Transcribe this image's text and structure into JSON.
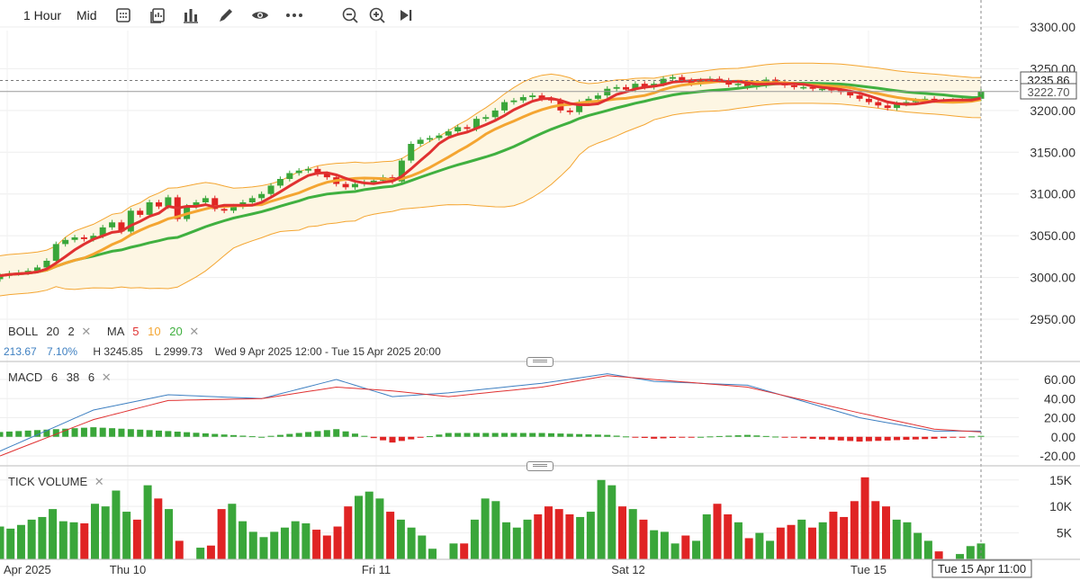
{
  "toolbar": {
    "interval": "1 Hour",
    "price_type": "Mid",
    "icons": [
      "calculator-icon",
      "layers-icon",
      "bar-chart-icon",
      "pencil-icon",
      "eye-icon",
      "more-icon",
      "zoom-out-icon",
      "zoom-in-icon",
      "skip-end-icon"
    ]
  },
  "price_panel": {
    "boll_label": "BOLL",
    "boll_period": "20",
    "boll_mult": "2",
    "ma_label": "MA",
    "ma_periods": [
      "5",
      "10",
      "20"
    ],
    "band_width": "213.67",
    "band_pct": "7.10%",
    "high": "H 3245.85",
    "low": "L 2999.73",
    "range": "Wed 9 Apr 2025 12:00 - Tue 15 Apr 2025 20:00",
    "tag_cursor": "3235.86",
    "tag_last": "3222.70"
  },
  "macd_panel": {
    "label": "MACD",
    "fast": "6",
    "slow": "38",
    "signal": "6"
  },
  "volume_panel": {
    "label": "TICK VOLUME"
  },
  "x_axis": {
    "labels": [
      "Apr 2025",
      "Thu 10",
      "Fri 11",
      "Sat 12",
      "Tue 15"
    ],
    "cursor_label": "Tue 15 Apr 11:00"
  },
  "colors": {
    "up": "#3aa63a",
    "down": "#e02424",
    "ma5": "#e03131",
    "ma10": "#f4a531",
    "ma20": "#40b040",
    "boll": "#f4a531",
    "macd": "#3d7fc1",
    "signal": "#e03131"
  },
  "chart_data": [
    {
      "type": "candlestick",
      "title": "",
      "y_ticks": [
        3300,
        3250,
        3200,
        3150,
        3100,
        3050,
        3000,
        2950
      ],
      "ylim": [
        2925,
        3315
      ],
      "close": [
        3002,
        3005,
        3006,
        3008,
        3012,
        3020,
        3040,
        3045,
        3048,
        3046,
        3050,
        3060,
        3066,
        3055,
        3080,
        3075,
        3090,
        3085,
        3096,
        3070,
        3085,
        3090,
        3095,
        3082,
        3080,
        3085,
        3090,
        3095,
        3100,
        3110,
        3118,
        3125,
        3128,
        3130,
        3124,
        3120,
        3112,
        3108,
        3112,
        3114,
        3116,
        3120,
        3115,
        3140,
        3160,
        3165,
        3167,
        3170,
        3175,
        3180,
        3178,
        3190,
        3192,
        3200,
        3210,
        3212,
        3216,
        3218,
        3214,
        3212,
        3200,
        3198,
        3210,
        3214,
        3218,
        3226,
        3228,
        3225,
        3232,
        3228,
        3232,
        3238,
        3240,
        3236,
        3232,
        3236,
        3238,
        3236,
        3231,
        3232,
        3228,
        3230,
        3237,
        3234,
        3230,
        3228,
        3228,
        3226,
        3226,
        3224,
        3222,
        3218,
        3214,
        3210,
        3206,
        3203,
        3208,
        3210,
        3212,
        3214,
        3212,
        3212,
        3212,
        3213,
        3214,
        3222.7
      ],
      "ma5_color": "#e03131",
      "ma10_color": "#f4a531",
      "ma20_color": "#40b040"
    },
    {
      "type": "line",
      "title": "",
      "y_ticks": [
        60,
        40,
        20,
        0,
        -20
      ],
      "ylim": [
        -27,
        72
      ],
      "macd_start": -15,
      "macd_points": [
        [
          0,
          -15
        ],
        [
          10,
          28
        ],
        [
          18,
          44
        ],
        [
          28,
          40
        ],
        [
          36,
          60
        ],
        [
          42,
          42
        ],
        [
          48,
          46
        ],
        [
          58,
          56
        ],
        [
          65,
          66
        ],
        [
          70,
          58
        ],
        [
          80,
          54
        ],
        [
          92,
          20
        ],
        [
          100,
          6
        ],
        [
          105,
          6
        ]
      ],
      "signal_points": [
        [
          0,
          -20
        ],
        [
          10,
          18
        ],
        [
          18,
          38
        ],
        [
          28,
          40
        ],
        [
          36,
          52
        ],
        [
          42,
          48
        ],
        [
          48,
          42
        ],
        [
          58,
          52
        ],
        [
          65,
          64
        ],
        [
          80,
          52
        ],
        [
          92,
          25
        ],
        [
          100,
          8
        ],
        [
          105,
          5
        ]
      ]
    },
    {
      "type": "bar",
      "title": "",
      "y_ticks": [
        "15K",
        "10K",
        "5K"
      ],
      "ylim": [
        0,
        17000
      ],
      "values": [
        6200,
        5800,
        6500,
        7500,
        8000,
        9500,
        7200,
        7000,
        6800,
        10500,
        10000,
        13000,
        9000,
        7500,
        14000,
        11500,
        9500,
        3500,
        0,
        2200,
        2600,
        9500,
        10500,
        7200,
        5200,
        4200,
        5200,
        6000,
        7200,
        6800,
        5600,
        4500,
        6200,
        10000,
        12000,
        12800,
        11500,
        9000,
        7500,
        6000,
        4500,
        2000,
        0,
        3000,
        3000,
        7500,
        11500,
        11000,
        7000,
        6000,
        7500,
        8500,
        10000,
        9500,
        8500,
        8000,
        9000,
        15000,
        14000,
        10000,
        9500,
        7500,
        5500,
        5200,
        3000,
        4500,
        3500,
        8500,
        10500,
        8500,
        7000,
        4000,
        5000,
        3500,
        6000,
        6500,
        7500,
        6000,
        7000,
        9000,
        8000,
        11000,
        15500,
        11000,
        10000,
        7500,
        7000,
        5000,
        3500,
        1500,
        0,
        1000,
        2500,
        3000
      ]
    }
  ]
}
